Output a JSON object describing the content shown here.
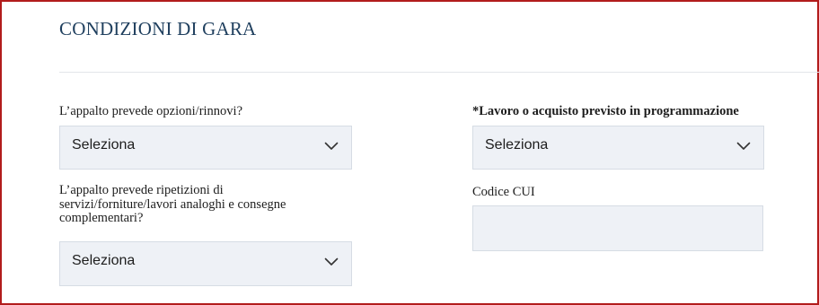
{
  "section": {
    "title": "CONDIZIONI DI GARA"
  },
  "fields": {
    "opzioni_rinnovi": {
      "label": "L’appalto prevede opzioni/rinnovi?",
      "value": "Seleziona"
    },
    "programmazione": {
      "label": "*Lavoro o acquisto previsto in programmazione",
      "value": "Seleziona"
    },
    "ripetizioni": {
      "label_lines": [
        "L’appalto prevede ripetizioni di",
        "servizi/forniture/lavori analoghi e consegne",
        "complementari?"
      ],
      "value": "Seleziona"
    },
    "codice_cui": {
      "label": "Codice CUI",
      "value": ""
    }
  },
  "icons": {
    "select_arrow": "chevron-down-icon"
  },
  "colors": {
    "frame_border": "#b21c1c",
    "title": "#1f3f5e",
    "field_background": "#eef1f6"
  }
}
